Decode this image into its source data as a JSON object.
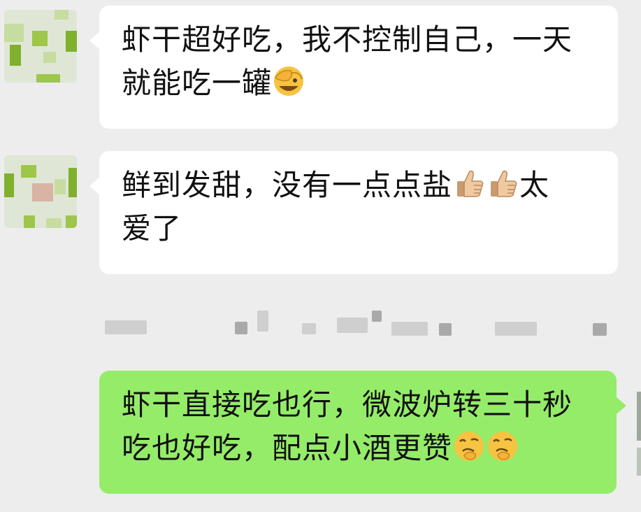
{
  "chat": {
    "messages": [
      {
        "direction": "incoming",
        "text": "虾干超好吃，我不控制自己，一天就能吃一罐",
        "emojis": [
          "face-palm-emoji"
        ]
      },
      {
        "direction": "incoming",
        "text": "鲜到发甜，没有一点点盐太爱了",
        "emojis": [
          "thumbs-up-emoji",
          "thumbs-up-emoji"
        ]
      },
      {
        "direction": "outgoing",
        "text": "虾干直接吃也行，微波炉转三十秒吃也好吃，配点小酒更赞",
        "emojis": [
          "smirk-hand-emoji",
          "smirk-hand-emoji"
        ]
      }
    ],
    "m1": {
      "a": "虾干超好吃，我不控制自己，一天",
      "b": "就能吃一罐"
    },
    "m2": {
      "a": "鲜到发甜，没有一点点盐",
      "b": "太",
      "c": "爱了"
    },
    "m3": {
      "a": "虾干直接吃也行，微波炉转三十秒",
      "b": "吃也好吃，配点小酒更赞"
    }
  },
  "colors": {
    "background": "#ededed",
    "incoming_bubble": "#ffffff",
    "outgoing_bubble": "#95ec69"
  }
}
